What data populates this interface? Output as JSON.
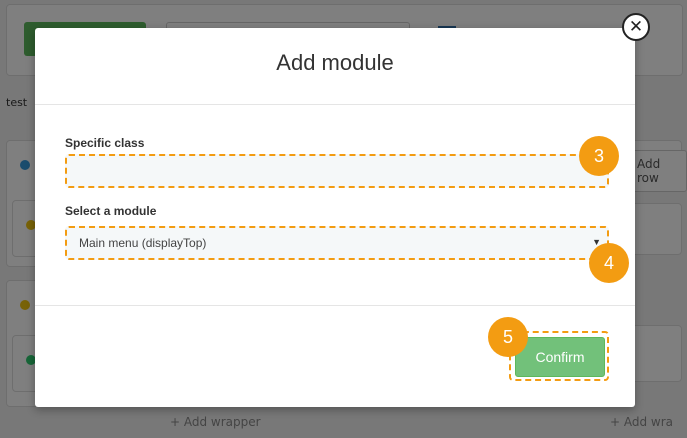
{
  "background": {
    "label": "test",
    "add_row": "Add row",
    "add_wrapper_left": "+ Add wrapper",
    "add_wrapper_right": "+ Add wra"
  },
  "modal": {
    "title": "Add module",
    "specific_class": {
      "label": "Specific class",
      "value": ""
    },
    "select_module": {
      "label": "Select a module",
      "value": "Main menu (displayTop)"
    },
    "confirm_label": "Confirm",
    "close_glyph": "✕"
  },
  "steps": [
    "3",
    "4",
    "5"
  ],
  "colors": {
    "accent": "#f39c12",
    "confirm": "#72c17a"
  }
}
